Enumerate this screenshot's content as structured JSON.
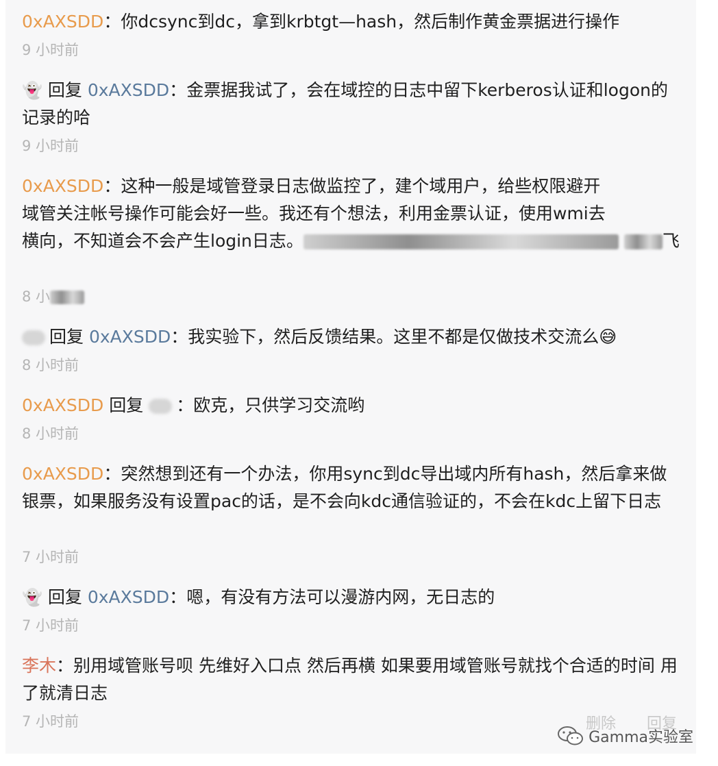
{
  "comments": [
    {
      "user": "0xAXSDD",
      "sep": "：",
      "text": "你dcsync到dc，拿到krbtgt—hash，然后制作黄金票据进行操作",
      "time": "9 小时前"
    },
    {
      "reply_word": "回复",
      "target": "0xAXSDD",
      "sep": "：",
      "text": "金票据我试了，会在域控的日志中留下kerberos认证和logon的记录的哈",
      "time": "9 小时前"
    },
    {
      "user": "0xAXSDD",
      "sep": "：",
      "text_line1": "这种一般是域管登录日志做监控了，建个域用户，给些权限避开",
      "text_line2": "域管关注帐号操作可能会好一些。我还有个想法，利用金票认证，使用wmi去",
      "text_line3": "横向，不知道会不会产生login日志。",
      "text_tail": "飞",
      "time": "8 小"
    },
    {
      "reply_word": "回复",
      "target": "0xAXSDD",
      "sep": "：",
      "text": "我实验下，然后反馈结果。这里不都是仅做技术交流么😅",
      "time": "8 小时前"
    },
    {
      "user": "0xAXSDD",
      "reply_word": "回复",
      "sep": "：",
      "text": "欧克，只供学习交流哟",
      "time": "8 小时前"
    },
    {
      "user": "0xAXSDD",
      "sep": "：",
      "text": "突然想到还有一个办法，你用sync到dc导出域内所有hash，然后拿来做银票，如果服务没有设置pac的话，是不会向kdc通信验证的，不会在kdc上留下日志",
      "time": "7 小时前"
    },
    {
      "reply_word": "回复",
      "target": "0xAXSDD",
      "sep": "：",
      "text": "嗯，有没有方法可以漫游内网，无日志的",
      "time": "7 小时前"
    },
    {
      "user": "李木",
      "sep": "：",
      "text": "别用域管账号呗 先维好入口点 然后再横 如果要用域管账号就找个合适的时间 用了就清日志",
      "time": "7 小时前"
    }
  ],
  "ghost_emoji": "👻",
  "actions": {
    "delete": "删除",
    "reply": "回复"
  },
  "watermark": "Gamma实验室",
  "colors": {
    "nick_orange": "#e89b4c",
    "nick_blue": "#5a7a9c",
    "nick_red": "#d9745a",
    "time": "#b5b5b5"
  }
}
